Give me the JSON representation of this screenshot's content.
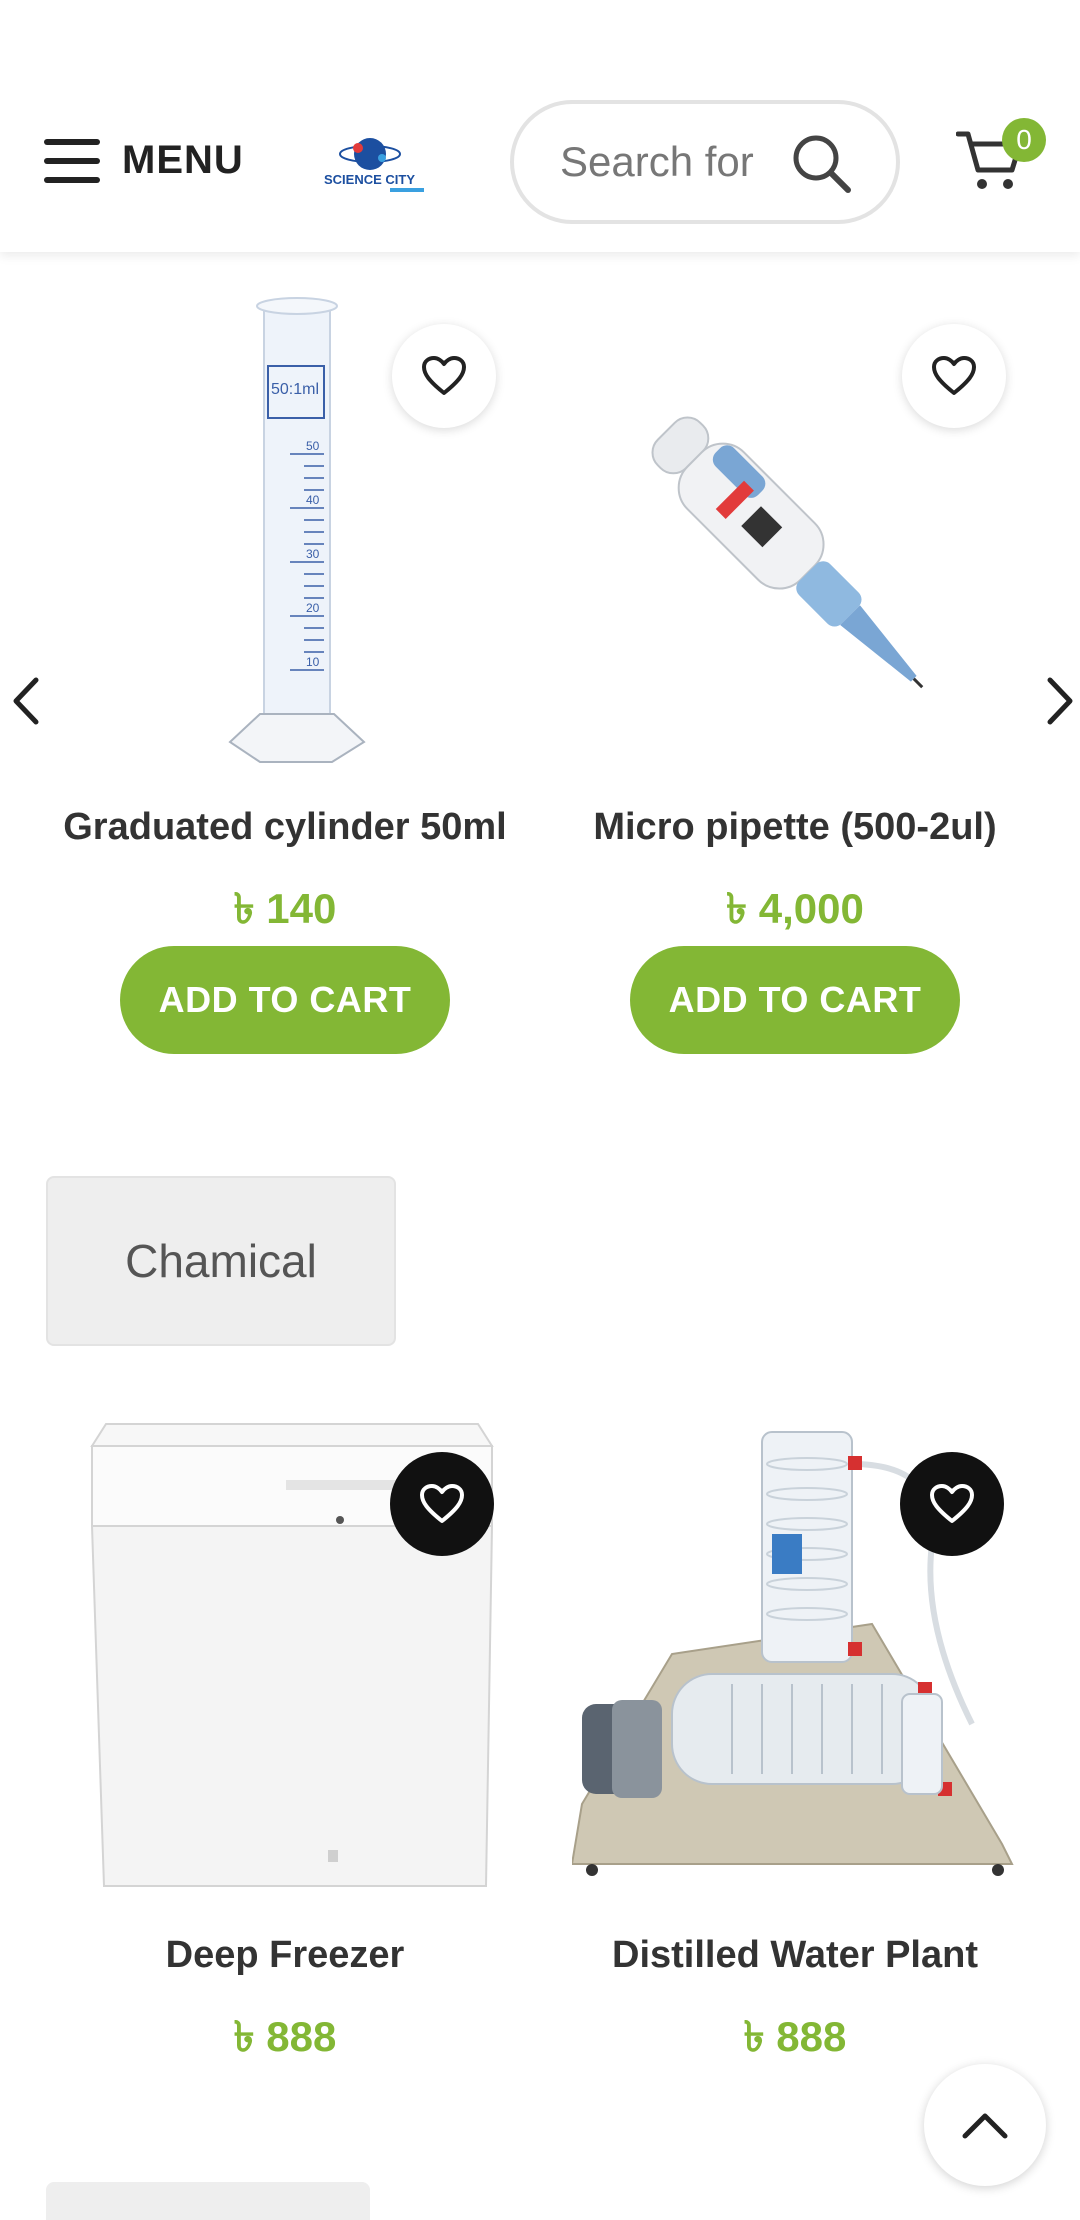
{
  "header": {
    "menu_label": "MENU",
    "logo_text": "SCIENCE CITY",
    "search_placeholder": "Search for",
    "cart_count": "0"
  },
  "colors": {
    "accent": "#83b735",
    "dark": "#111111",
    "category_bg": "#eeeeee"
  },
  "products": [
    {
      "title": "Graduated cylinder 50ml",
      "price": "৳ 140",
      "button": "ADD TO CART",
      "image": "graduated-cylinder"
    },
    {
      "title": "Micro pipette (500-2ul)",
      "price": "৳ 4,000",
      "button": "ADD TO CART",
      "image": "micro-pipette"
    },
    {
      "title": "Deep Freezer",
      "price": "৳ 888",
      "image": "deep-freezer"
    },
    {
      "title": "Distilled Water Plant",
      "price": "৳ 888",
      "image": "distilled-water-plant"
    }
  ],
  "category": {
    "label": "Chamical"
  },
  "cylinder_label": "50:1ml",
  "cylinder_ticks": [
    "50",
    "40",
    "30",
    "20",
    "10"
  ]
}
